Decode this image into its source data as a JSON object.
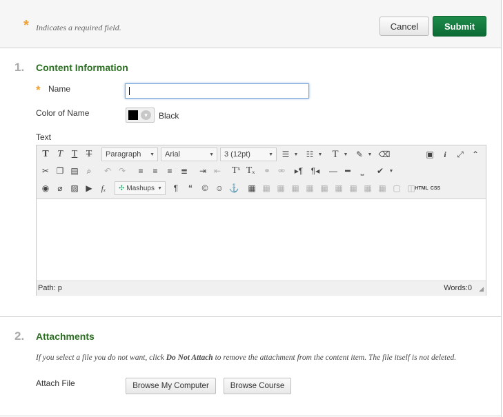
{
  "header": {
    "required_note": "Indicates a required field.",
    "cancel_label": "Cancel",
    "submit_label": "Submit"
  },
  "sections": {
    "content": {
      "number": "1.",
      "title": "Content Information",
      "name_label": "Name",
      "name_value": "",
      "color_label": "Color of Name",
      "color_value": "Black",
      "color_swatch": "#000000",
      "text_label": "Text"
    },
    "attachments": {
      "number": "2.",
      "title": "Attachments",
      "note_prefix": "If you select a file you do not want, click ",
      "note_bold": "Do Not Attach",
      "note_suffix": " to remove the attachment from the content item. The file itself is not deleted.",
      "attach_label": "Attach File",
      "browse_computer": "Browse My Computer",
      "browse_course": "Browse Course"
    }
  },
  "editor": {
    "format_select": "Paragraph",
    "font_select": "Arial",
    "size_select": "3 (12pt)",
    "mashups_label": "Mashups",
    "html_label": "HTML",
    "css_label": "CSS",
    "path_label": "Path: p",
    "word_count": "Words:0"
  },
  "colors": {
    "accent_green": "#2b6e21",
    "submit_green": "#0c6a34",
    "required_star": "#f0a030"
  }
}
